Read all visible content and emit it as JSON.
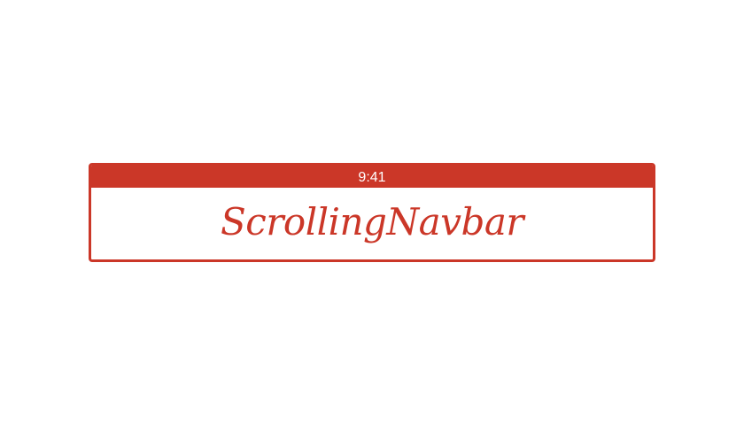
{
  "status_bar": {
    "time": "9:41"
  },
  "navbar": {
    "title": "ScrollingNavbar"
  },
  "colors": {
    "accent": "#cb3728",
    "background": "#ffffff",
    "status_text": "#ffffff"
  }
}
